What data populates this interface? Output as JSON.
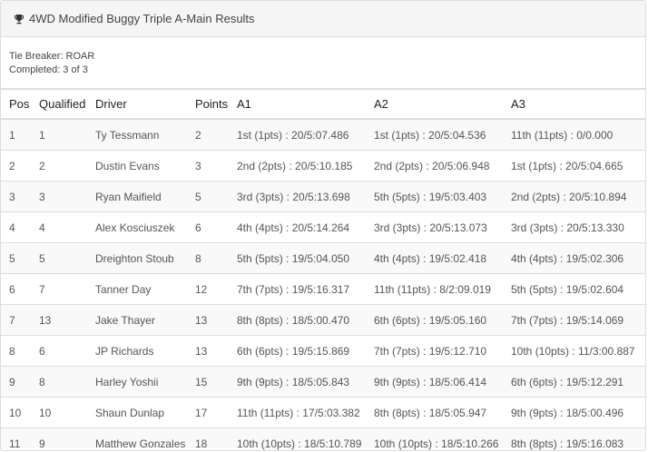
{
  "header": {
    "title": "4WD Modified Buggy Triple A-Main Results",
    "icon": "trophy-icon"
  },
  "info": {
    "tie_breaker": "Tie Breaker: ROAR",
    "completed": "Completed: 3 of 3"
  },
  "table": {
    "columns": [
      "Pos",
      "Qualified",
      "Driver",
      "Points",
      "A1",
      "A2",
      "A3"
    ],
    "rows": [
      [
        "1",
        "1",
        "Ty Tessmann",
        "2",
        "1st (1pts) : 20/5:07.486",
        "1st (1pts) : 20/5:04.536",
        "11th (11pts) : 0/0.000"
      ],
      [
        "2",
        "2",
        "Dustin Evans",
        "3",
        "2nd (2pts) : 20/5:10.185",
        "2nd (2pts) : 20/5:06.948",
        "1st (1pts) : 20/5:04.665"
      ],
      [
        "3",
        "3",
        "Ryan Maifield",
        "5",
        "3rd (3pts) : 20/5:13.698",
        "5th (5pts) : 19/5:03.403",
        "2nd (2pts) : 20/5:10.894"
      ],
      [
        "4",
        "4",
        "Alex Kosciuszek",
        "6",
        "4th (4pts) : 20/5:14.264",
        "3rd (3pts) : 20/5:13.073",
        "3rd (3pts) : 20/5:13.330"
      ],
      [
        "5",
        "5",
        "Dreighton Stoub",
        "8",
        "5th (5pts) : 19/5:04.050",
        "4th (4pts) : 19/5:02.418",
        "4th (4pts) : 19/5:02.306"
      ],
      [
        "6",
        "7",
        "Tanner Day",
        "12",
        "7th (7pts) : 19/5:16.317",
        "11th (11pts) : 8/2:09.019",
        "5th (5pts) : 19/5:02.604"
      ],
      [
        "7",
        "13",
        "Jake Thayer",
        "13",
        "8th (8pts) : 18/5:00.470",
        "6th (6pts) : 19/5:05.160",
        "7th (7pts) : 19/5:14.069"
      ],
      [
        "8",
        "6",
        "JP Richards",
        "13",
        "6th (6pts) : 19/5:15.869",
        "7th (7pts) : 19/5:12.710",
        "10th (10pts) : 11/3:00.887"
      ],
      [
        "9",
        "8",
        "Harley Yoshii",
        "15",
        "9th (9pts) : 18/5:05.843",
        "9th (9pts) : 18/5:06.414",
        "6th (6pts) : 19/5:12.291"
      ],
      [
        "10",
        "10",
        "Shaun Dunlap",
        "17",
        "11th (11pts) : 17/5:03.382",
        "8th (8pts) : 18/5:05.947",
        "9th (9pts) : 18/5:00.496"
      ],
      [
        "11",
        "9",
        "Matthew Gonzales",
        "18",
        "10th (10pts) : 18/5:10.789",
        "10th (10pts) : 18/5:10.266",
        "8th (8pts) : 19/5:16.083"
      ]
    ]
  }
}
